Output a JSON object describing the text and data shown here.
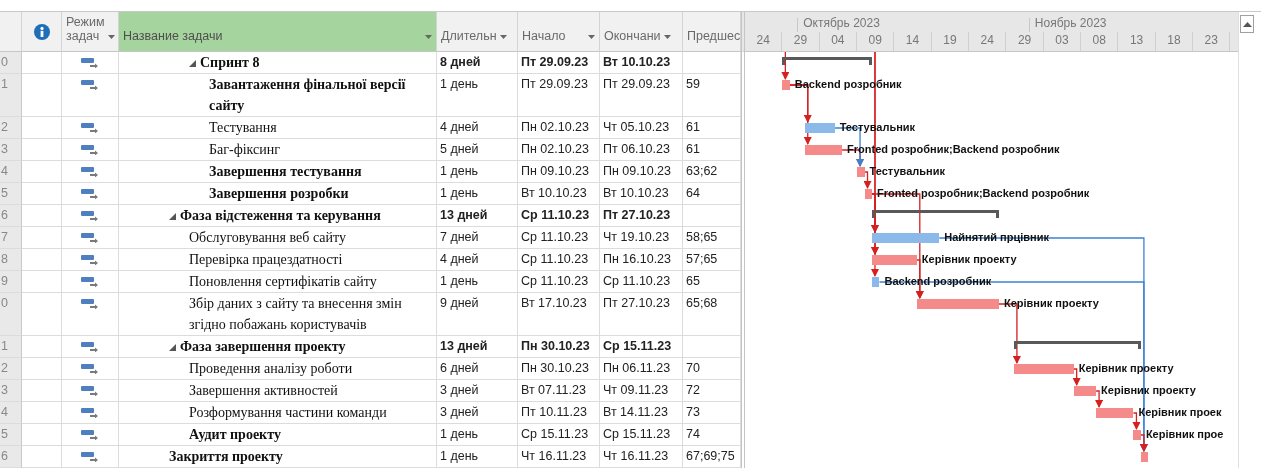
{
  "columns": [
    {
      "kind": "number",
      "selected": false
    },
    {
      "kind": "info",
      "selected": false
    },
    {
      "kind": "mode",
      "label": "Режим задач",
      "selected": false
    },
    {
      "kind": "name",
      "label": "Название задачи",
      "selected": true
    },
    {
      "kind": "duration",
      "label": "Длительн",
      "selected": false
    },
    {
      "kind": "start",
      "label": "Начало",
      "selected": false
    },
    {
      "kind": "finish",
      "label": "Окончани",
      "selected": false
    },
    {
      "kind": "predecessors",
      "label": "Предшес",
      "selected": false
    }
  ],
  "timescale": {
    "months": [
      "Октябрь 2023",
      "Ноябрь 2023"
    ],
    "days": [
      "24",
      "29",
      "04",
      "09",
      "14",
      "19",
      "24",
      "29",
      "03",
      "08",
      "13",
      "18",
      "23"
    ]
  },
  "tasks": [
    {
      "kind": "continued",
      "children": [
        {
          "kind": "summary",
          "row_number": "0",
          "name": "Спринт 8",
          "bold": true,
          "expanded": true,
          "duration": "8 дней",
          "start": "Пт 29.09.23",
          "finish": "Вт 10.10.23",
          "children": [
            {
              "kind": "task",
              "row_number": "1",
              "name": "Завантаження фінальної версії сайту",
              "bold": true,
              "duration": "1 день",
              "start": "Пт 29.09.23",
              "finish": "Пт 29.09.23",
              "predecessors": "59",
              "resources": "Backend розробник",
              "critical": true
            },
            {
              "kind": "task",
              "row_number": "2",
              "name": "Тестування",
              "bold": false,
              "duration": "4 дней",
              "start": "Пн 02.10.23",
              "finish": "Чт 05.10.23",
              "predecessors": "61",
              "resources": "Тестувальник",
              "critical": false
            },
            {
              "kind": "task",
              "row_number": "3",
              "name": "Баг-фіксинг",
              "bold": false,
              "duration": "5 дней",
              "start": "Пн 02.10.23",
              "finish": "Пт 06.10.23",
              "predecessors": "61",
              "resources": "Fronted розробник;Backend розробник",
              "critical": true
            },
            {
              "kind": "task",
              "row_number": "4",
              "name": "Завершення тестування",
              "bold": true,
              "duration": "1 день",
              "start": "Пн 09.10.23",
              "finish": "Пн 09.10.23",
              "predecessors": "63;62",
              "resources": "Тестувальник",
              "critical": true
            },
            {
              "kind": "task",
              "row_number": "5",
              "name": "Завершення розробки",
              "bold": true,
              "duration": "1 день",
              "start": "Вт 10.10.23",
              "finish": "Вт 10.10.23",
              "predecessors": "64",
              "resources": "Fronted розробник;Backend розробник",
              "critical": true
            }
          ]
        }
      ]
    },
    {
      "kind": "summary",
      "row_number": "6",
      "name": "Фаза відстеження та керування",
      "bold": true,
      "expanded": true,
      "duration": "13 дней",
      "start": "Ср 11.10.23",
      "finish": "Пт 27.10.23",
      "children": [
        {
          "kind": "task",
          "row_number": "7",
          "name": "Обслуговування веб сайту",
          "bold": false,
          "duration": "7 дней",
          "start": "Ср 11.10.23",
          "finish": "Чт 19.10.23",
          "predecessors": "58;65",
          "resources": "Найнятий прцівник",
          "critical": false
        },
        {
          "kind": "task",
          "row_number": "8",
          "name": "Перевірка працездатності",
          "bold": false,
          "duration": "4 дней",
          "start": "Ср 11.10.23",
          "finish": "Пн 16.10.23",
          "predecessors": "57;65",
          "resources": "Керівник проекту",
          "critical": true
        },
        {
          "kind": "task",
          "row_number": "9",
          "name": "Поновлення сертифікатів сайту",
          "bold": false,
          "duration": "1 день",
          "start": "Ср 11.10.23",
          "finish": "Ср 11.10.23",
          "predecessors": "65",
          "resources": "Backend розробник",
          "critical": false
        },
        {
          "kind": "task",
          "row_number": "0",
          "name": "Збір даних з сайту та внесення змін згідно побажань користувачів",
          "bold": false,
          "duration": "9 дней",
          "start": "Вт 17.10.23",
          "finish": "Пт 27.10.23",
          "predecessors": "65;68",
          "resources": "Керівник проекту",
          "critical": true
        }
      ]
    },
    {
      "kind": "summary",
      "row_number": "1",
      "name": "Фаза завершення проекту",
      "bold": true,
      "expanded": true,
      "duration": "13 дней",
      "start": "Пн 30.10.23",
      "finish": "Ср 15.11.23",
      "children": [
        {
          "kind": "task",
          "row_number": "2",
          "name": "Проведення аналізу роботи",
          "bold": false,
          "duration": "6 дней",
          "start": "Пн 30.10.23",
          "finish": "Пн 06.11.23",
          "predecessors": "70",
          "resources": "Керівник проекту",
          "critical": true
        },
        {
          "kind": "task",
          "row_number": "3",
          "name": "Завершення активностей",
          "bold": false,
          "duration": "3 дней",
          "start": "Вт 07.11.23",
          "finish": "Чт 09.11.23",
          "predecessors": "72",
          "resources": "Керівник проекту",
          "critical": true
        },
        {
          "kind": "task",
          "row_number": "4",
          "name": "Розформування частини команди",
          "bold": false,
          "duration": "3 дней",
          "start": "Пт 10.11.23",
          "finish": "Вт 14.11.23",
          "predecessors": "73",
          "resources": "Керівник проек",
          "critical": true
        },
        {
          "kind": "task",
          "row_number": "5",
          "name": "Аудит проекту",
          "bold": true,
          "duration": "1 день",
          "start": "Ср 15.11.23",
          "finish": "Ср 15.11.23",
          "predecessors": "74",
          "resources": "Керівник прое",
          "critical": true
        }
      ]
    },
    {
      "kind": "task",
      "row_number": "6",
      "name": "Закриття проекту",
      "bold": true,
      "duration": "1 день",
      "start": "Чт 16.11.23",
      "finish": "Чт 16.11.23",
      "predecessors": "67;69;75",
      "critical": true
    }
  ]
}
